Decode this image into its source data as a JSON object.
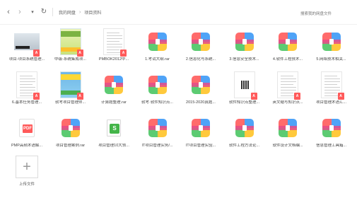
{
  "nav": {
    "back_icon": "‹",
    "forward_icon": "›",
    "dropdown_icon": "▾",
    "refresh_icon": "↻"
  },
  "breadcrumb": {
    "root": "我的网盘",
    "current": "项目资料"
  },
  "search": {
    "placeholder": "搜索我的网盘文件"
  },
  "files": [
    {
      "name": "项目-项目系统管理...",
      "type": "pdf",
      "thumb": "photo"
    },
    {
      "name": "中级-系统集成项...",
      "type": "pdf",
      "thumb": "book-green"
    },
    {
      "name": "PMBOK2012中...",
      "type": "pdf",
      "thumb": "doc"
    },
    {
      "name": "1.考试大纲.rar",
      "type": "rar"
    },
    {
      "name": "2.信息化与系统...",
      "type": "rar"
    },
    {
      "name": "3.信息安全技术...",
      "type": "rar"
    },
    {
      "name": "4.软件工程技术...",
      "type": "rar"
    },
    {
      "name": "5.网络技术相关...",
      "type": "rar"
    },
    {
      "name": "6.基本任务管理...",
      "type": "pdf",
      "thumb": "doc"
    },
    {
      "name": "软考项目管理师...",
      "type": "pdf",
      "thumb": "book-blue"
    },
    {
      "name": "计算题整理.rar",
      "type": "rar"
    },
    {
      "name": "软考·软件知识点...",
      "type": "rar"
    },
    {
      "name": "2015-2020真题...",
      "type": "rar"
    },
    {
      "name": "软件知识点整理...",
      "type": "pdf",
      "thumb": "qr"
    },
    {
      "name": "英文缩写知识点...",
      "type": "pdf",
      "thumb": "doc"
    },
    {
      "name": "项目管理术语汇...",
      "type": "pdf",
      "thumb": "doc"
    },
    {
      "name": "PMP高频术语解...",
      "type": "pdf",
      "thumb": "plainpdf"
    },
    {
      "name": "项目管理案例.rar",
      "type": "rar"
    },
    {
      "name": "项目管理10大领...",
      "type": "xls"
    },
    {
      "name": "IT项目管理实务/...",
      "type": "rar"
    },
    {
      "name": "IT项目管理实验...",
      "type": "rar"
    },
    {
      "name": "软件工程方法论...",
      "type": "rar"
    },
    {
      "name": "软件设计文档编...",
      "type": "rar"
    },
    {
      "name": "信息管理工具箱...",
      "type": "rar"
    }
  ],
  "upload": {
    "icon": "+",
    "label": "上传文件"
  }
}
